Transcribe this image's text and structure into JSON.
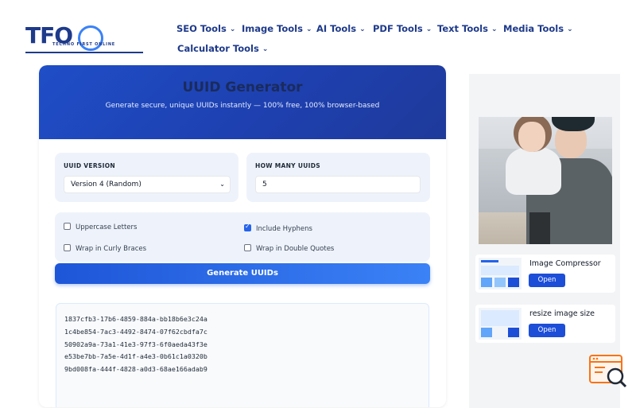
{
  "brand": {
    "logo_text": "TFO",
    "tagline": "TECHNO FIRST ONLINE",
    "color": "#1e3a8a",
    "accent": "#3b82f6"
  },
  "nav": {
    "items": [
      {
        "label": "SEO Tools",
        "icon": "chevron-down-icon"
      },
      {
        "label": "Image Tools",
        "icon": "chevron-down-icon"
      },
      {
        "label": "AI Tools",
        "icon": "chevron-down-icon"
      },
      {
        "label": "PDF Tools",
        "icon": "chevron-down-icon"
      },
      {
        "label": "Text Tools",
        "icon": "chevron-down-icon"
      },
      {
        "label": "Media Tools",
        "icon": "chevron-down-icon"
      },
      {
        "label": "Calculator Tools",
        "icon": "chevron-down-icon"
      }
    ]
  },
  "tool": {
    "title": "UUID Generator",
    "subtitle": "Generate secure, unique UUIDs instantly — 100% free, 100% browser-based",
    "version_label": "UUID VERSION",
    "version_value": "Version 4 (Random)",
    "count_label": "HOW MANY UUIDS",
    "count_value": "5",
    "options": {
      "uppercase": {
        "label": "Uppercase Letters",
        "checked": false
      },
      "hyphens": {
        "label": "Include Hyphens",
        "checked": true
      },
      "curly": {
        "label": "Wrap in Curly Braces",
        "checked": false
      },
      "quotes": {
        "label": "Wrap in Double Quotes",
        "checked": false
      }
    },
    "generate_label": "Generate UUIDs",
    "output": [
      "1837cfb3-17b6-4859-884a-bb18b6e3c24a",
      "1c4be854-7ac3-4492-8474-07f62cbdfa7c",
      "50902a9a-73a1-41e3-97f3-6f0aeda43f3e",
      "e53be7bb-7a5e-4d1f-a4e3-0b61c1a0320b",
      "9bd008fa-444f-4828-a0d3-68ae166adab9"
    ],
    "colors": {
      "hero": "#1f4ec7",
      "button": "#2563eb",
      "check": "#2563eb"
    }
  },
  "sidebar": {
    "related": [
      {
        "title": "Image Compressor",
        "button": "Open"
      },
      {
        "title": "resize image size",
        "button": "Open"
      }
    ]
  }
}
